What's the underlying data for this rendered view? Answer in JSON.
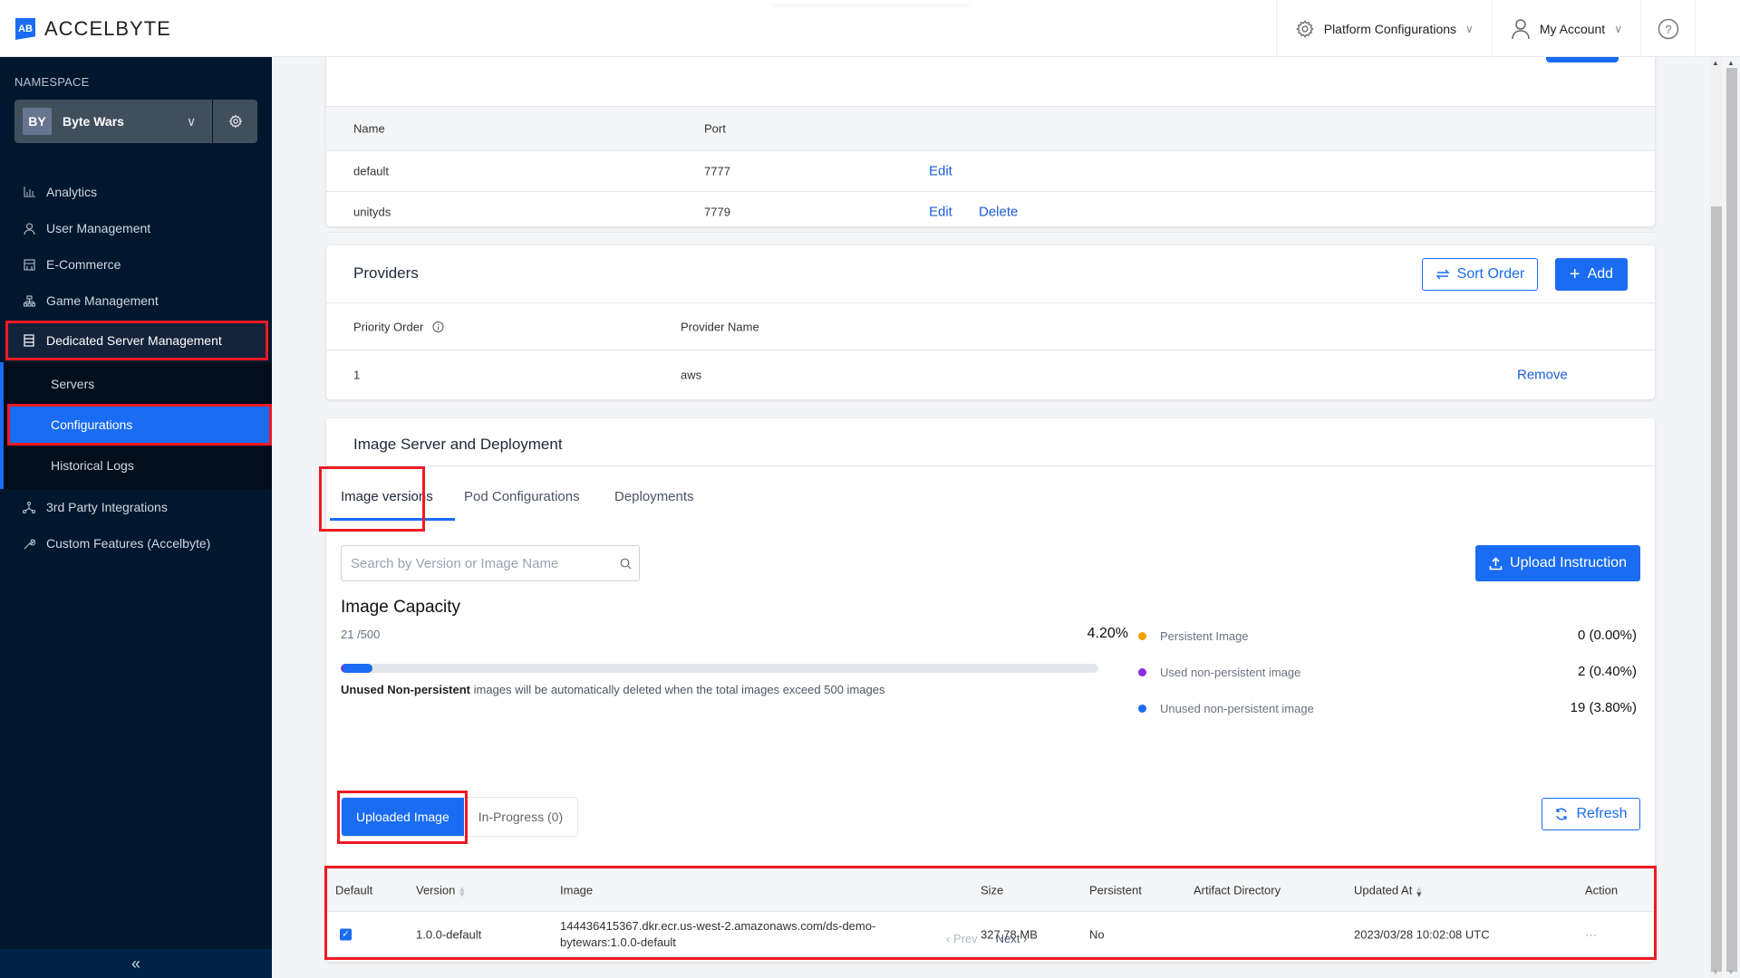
{
  "brand": {
    "name": "ACCELBYTE",
    "mark": "AB",
    "accent": "#1a6cf2",
    "highlight": "#ef1a24"
  },
  "topnav": {
    "platform_config": "Platform Configurations",
    "my_account": "My Account",
    "help": "?"
  },
  "sidebar": {
    "namespace_label": "NAMESPACE",
    "namespace_badge": "BY",
    "namespace_name": "Byte Wars",
    "items": [
      {
        "label": "Analytics",
        "icon": "bar-chart-icon"
      },
      {
        "label": "User Management",
        "icon": "user-icon"
      },
      {
        "label": "E-Commerce",
        "icon": "store-icon"
      },
      {
        "label": "Game Management",
        "icon": "hierarchy-icon"
      },
      {
        "label": "Dedicated Server Management",
        "icon": "server-icon",
        "active": true
      },
      {
        "label": "3rd Party Integrations",
        "icon": "integration-icon"
      },
      {
        "label": "Custom Features (Accelbyte)",
        "icon": "wrench-icon"
      }
    ],
    "sub_items": [
      {
        "label": "Servers"
      },
      {
        "label": "Configurations",
        "active": true
      },
      {
        "label": "Historical Logs"
      }
    ],
    "collapse": "«"
  },
  "ports": {
    "headers": [
      "Name",
      "Port"
    ],
    "rows": [
      {
        "name": "default",
        "port": "7777",
        "edit": "Edit"
      },
      {
        "name": "unityds",
        "port": "7779",
        "edit": "Edit",
        "delete": "Delete"
      }
    ]
  },
  "providers": {
    "title": "Providers",
    "sort_order": "Sort Order",
    "add": "Add",
    "headers": [
      "Priority Order",
      "Provider Name"
    ],
    "rows": [
      {
        "priority": "1",
        "name": "aws",
        "remove": "Remove"
      }
    ]
  },
  "image_section": {
    "title": "Image Server and Deployment",
    "tabs": [
      "Image versions",
      "Pod Configurations",
      "Deployments"
    ],
    "active_tab": "Image versions",
    "search_placeholder": "Search by Version or Image Name",
    "upload_instruction": "Upload Instruction",
    "capacity": {
      "title": "Image Capacity",
      "count": "21 /500",
      "percent": "4.20%",
      "fill_fraction": 0.042,
      "note_bold": "Unused Non-persistent",
      "note_rest": " images will be automatically deleted when the total images exceed 500 images",
      "legend": [
        {
          "label": "Persistent Image",
          "value": "0 (0.00%)",
          "color": "#f59e0b"
        },
        {
          "label": "Used non-persistent image",
          "value": "2 (0.40%)",
          "color": "#8b2be2"
        },
        {
          "label": "Unused non-persistent image",
          "value": "19 (3.80%)",
          "color": "#1a6cf2"
        }
      ]
    },
    "segments": [
      "Uploaded Image",
      "In-Progress (0)"
    ],
    "refresh": "Refresh",
    "table": {
      "headers": [
        "Default",
        "Version",
        "Image",
        "Size",
        "Persistent",
        "Artifact Directory",
        "Updated At",
        "Action"
      ],
      "rows": [
        {
          "default": true,
          "version": "1.0.0-default",
          "image_line1": "144436415367.dkr.ecr.us-west-2.amazonaws.com/ds-demo-",
          "image_line2": "bytewars:1.0.0-default",
          "size": "327.78 MB",
          "persistent": "No",
          "artifact_directory": "",
          "updated_at": "2023/03/28 10:02:08 UTC",
          "action": "···"
        }
      ]
    },
    "pager": {
      "prev": "‹ Prev",
      "next": "Next ›"
    }
  }
}
